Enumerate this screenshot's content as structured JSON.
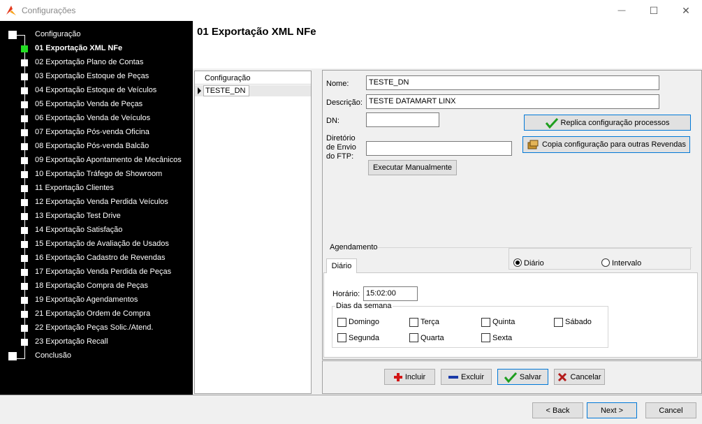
{
  "window": {
    "title": "Configurações",
    "minimize_glyph": "—",
    "maximize_glyph": "☐",
    "close_glyph": "✕"
  },
  "wizard": {
    "items": [
      {
        "label": "Configuração"
      },
      {
        "label": "01 Exportação XML NFe"
      },
      {
        "label": "02 Exportação Plano de Contas"
      },
      {
        "label": "03 Exportação Estoque de Peças"
      },
      {
        "label": "04 Exportação Estoque de Veículos"
      },
      {
        "label": "05 Exportação Venda de Peças"
      },
      {
        "label": "06 Exportação Venda de Veículos"
      },
      {
        "label": "07 Exportação Pós-venda Oficina"
      },
      {
        "label": "08 Exportação Pós-venda Balcão"
      },
      {
        "label": "09 Exportação Apontamento de Mecânicos"
      },
      {
        "label": "10 Exportação Tráfego de Showroom"
      },
      {
        "label": "11 Exportação Clientes"
      },
      {
        "label": "12 Exportação Venda Perdida Veículos"
      },
      {
        "label": "13 Exportação Test Drive"
      },
      {
        "label": "14 Exportação Satisfação"
      },
      {
        "label": "15 Exportação de Avaliação de Usados"
      },
      {
        "label": "16 Exportação Cadastro de Revendas"
      },
      {
        "label": "17 Exportação Venda Perdida de Peças"
      },
      {
        "label": "18 Exportação Compra de Peças"
      },
      {
        "label": "19 Exportação Agendamentos"
      },
      {
        "label": "21 Exportação Ordem de Compra"
      },
      {
        "label": "22 Exportação Peças Solic./Atend."
      },
      {
        "label": "23 Exportação Recall"
      },
      {
        "label": "Conclusão"
      }
    ]
  },
  "page": {
    "title": "01 Exportação XML NFe"
  },
  "grid": {
    "header": "Configuração",
    "rows": [
      {
        "value": "TESTE_DN"
      }
    ]
  },
  "form": {
    "nome_label": "Nome:",
    "nome_value": "TESTE_DN",
    "descricao_label": "Descrição:",
    "descricao_value": "TESTE DATAMART LINX",
    "dn_label": "DN:",
    "dn_value": "",
    "ftp_label_1": "Diretório",
    "ftp_label_2": "de Envio",
    "ftp_label_3": "do FTP:",
    "ftp_value": "",
    "executar_label": "Executar Manualmente",
    "replica_label": "Replica configuração processos",
    "copia_label": "Copia configuração para outras Revendas"
  },
  "agendamento": {
    "group_label": "Agendamento",
    "tab_label": "Diário",
    "radio_diario": "Diário",
    "radio_intervalo": "Intervalo",
    "selected": "Diário",
    "horario_label": "Horário:",
    "horario_value": "15:02:00",
    "dias_label": "Dias da semana",
    "dias": [
      "Domingo",
      "Terça",
      "Quinta",
      "Sábado",
      "Segunda",
      "Quarta",
      "Sexta"
    ]
  },
  "actions": {
    "incluir": "Incluir",
    "excluir": "Excluir",
    "salvar": "Salvar",
    "cancelar": "Cancelar"
  },
  "nav": {
    "back": "< Back",
    "next": "Next >",
    "cancel": "Cancel"
  },
  "colors": {
    "wizard_bg": "#000000",
    "current_step": "#22dd22",
    "focus_border": "#0078d7"
  }
}
